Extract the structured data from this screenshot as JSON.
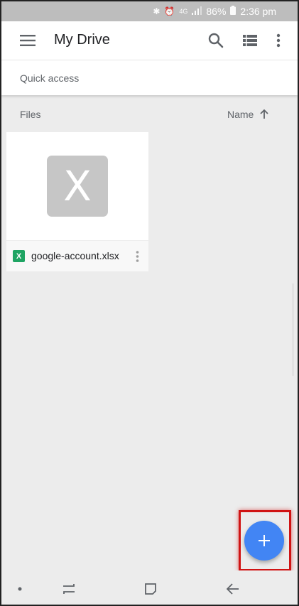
{
  "status_bar": {
    "battery": "86%",
    "time": "2:36 pm",
    "icons": [
      "bluetooth-icon",
      "alarm-icon",
      "network-4g-icon",
      "signal-icon",
      "battery-icon"
    ],
    "network_label": "4G"
  },
  "app_bar": {
    "title": "My Drive",
    "icons": [
      "menu-icon",
      "search-icon",
      "list-view-icon",
      "more-vert-icon"
    ]
  },
  "quick_access": {
    "label": "Quick access"
  },
  "files_section": {
    "label": "Files",
    "sort_label": "Name",
    "sort_icon": "arrow-up-icon"
  },
  "files": [
    {
      "name": "google-account.xlsx",
      "type_letter": "X",
      "type_icon_letter": "X"
    }
  ],
  "fab": {
    "icon": "plus-icon",
    "symbol": "+"
  },
  "nav_bar": {
    "icons": [
      "nav-dot-icon",
      "recent-apps-icon",
      "home-icon",
      "back-icon"
    ]
  },
  "colors": {
    "status_bar": "#bdbdbd",
    "background": "#ececec",
    "fab": "#4285f4",
    "highlight": "#d01414",
    "xlsx": "#1fa463"
  }
}
